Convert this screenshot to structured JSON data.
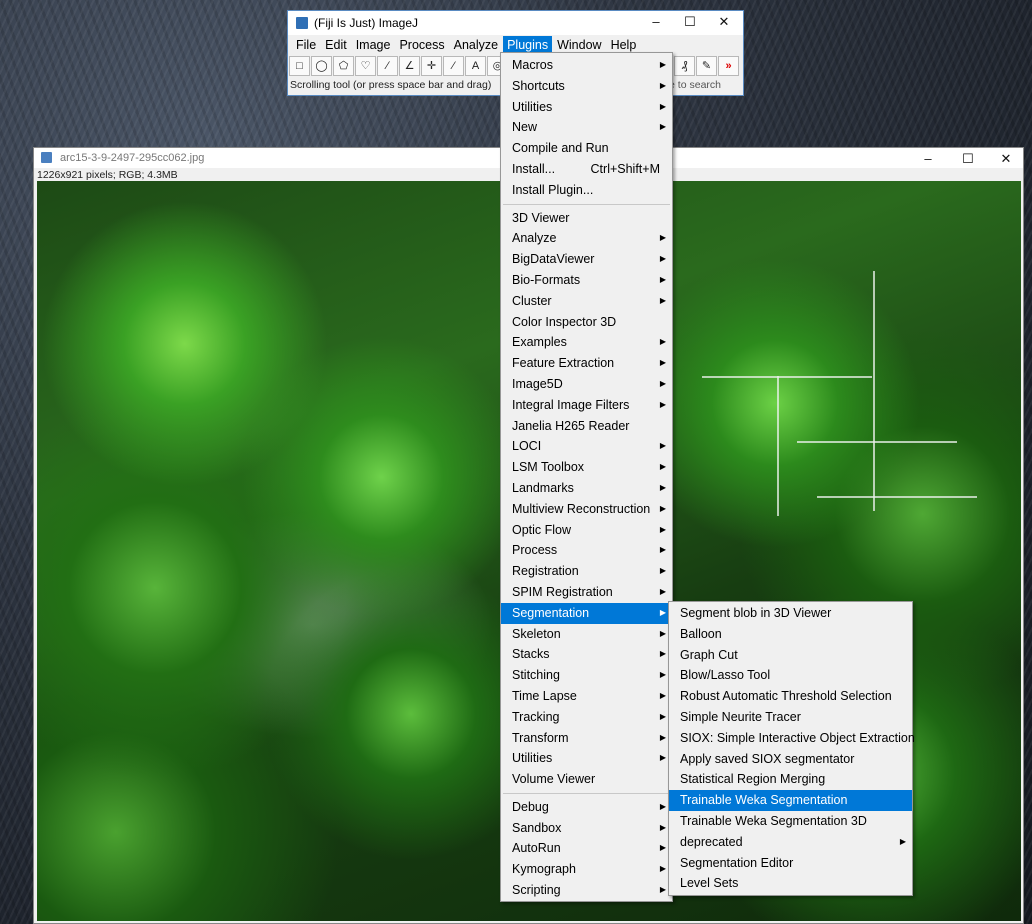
{
  "main_window": {
    "title": "(Fiji Is Just) ImageJ",
    "menubar": [
      "File",
      "Edit",
      "Image",
      "Process",
      "Analyze",
      "Plugins",
      "Window",
      "Help"
    ],
    "active_menu": "Plugins",
    "tools": [
      "rectangle-tool",
      "oval-tool",
      "polygon-tool",
      "freehand-tool",
      "line-tool",
      "angle-tool",
      "point-tool",
      "wand-tool",
      "text-tool",
      "zoom-tool"
    ],
    "right_tools": [
      "image-tool",
      "developer-tool",
      "more-tools"
    ],
    "tool_glyphs": [
      "□",
      "◯",
      "⬠",
      "♡",
      "∕",
      "∠",
      "✛",
      "⁄",
      "A",
      "◎"
    ],
    "right_glyphs": [
      "₰",
      "✎",
      "»"
    ],
    "status": "Scrolling tool (or press space bar and drag)",
    "status_right": "e to search"
  },
  "image_window": {
    "title": "arc15-3-9-2497-295cc062.jpg",
    "info": "1226x921 pixels; RGB; 4.3MB"
  },
  "plugins_menu": {
    "group1": [
      {
        "label": "Macros",
        "sub": true
      },
      {
        "label": "Shortcuts",
        "sub": true
      },
      {
        "label": "Utilities",
        "sub": true
      },
      {
        "label": "New",
        "sub": true
      },
      {
        "label": "Compile and Run"
      },
      {
        "label": "Install...",
        "accel": "Ctrl+Shift+M"
      },
      {
        "label": "Install Plugin..."
      }
    ],
    "group2": [
      {
        "label": "3D Viewer"
      },
      {
        "label": "Analyze",
        "sub": true
      },
      {
        "label": "BigDataViewer",
        "sub": true
      },
      {
        "label": "Bio-Formats",
        "sub": true
      },
      {
        "label": "Cluster",
        "sub": true
      },
      {
        "label": "Color Inspector 3D"
      },
      {
        "label": "Examples",
        "sub": true
      },
      {
        "label": "Feature Extraction",
        "sub": true
      },
      {
        "label": "Image5D",
        "sub": true
      },
      {
        "label": "Integral Image Filters",
        "sub": true
      },
      {
        "label": "Janelia H265 Reader"
      },
      {
        "label": "LOCI",
        "sub": true
      },
      {
        "label": "LSM Toolbox",
        "sub": true
      },
      {
        "label": "Landmarks",
        "sub": true
      },
      {
        "label": "Multiview Reconstruction",
        "sub": true
      },
      {
        "label": "Optic Flow",
        "sub": true
      },
      {
        "label": "Process",
        "sub": true
      },
      {
        "label": "Registration",
        "sub": true
      },
      {
        "label": "SPIM Registration",
        "sub": true
      },
      {
        "label": "Segmentation",
        "sub": true,
        "highlight": true
      },
      {
        "label": "Skeleton",
        "sub": true
      },
      {
        "label": "Stacks",
        "sub": true
      },
      {
        "label": "Stitching",
        "sub": true
      },
      {
        "label": "Time Lapse",
        "sub": true
      },
      {
        "label": "Tracking",
        "sub": true
      },
      {
        "label": "Transform",
        "sub": true
      },
      {
        "label": "Utilities",
        "sub": true
      },
      {
        "label": "Volume Viewer"
      }
    ],
    "group3": [
      {
        "label": "Debug",
        "sub": true
      },
      {
        "label": "Sandbox",
        "sub": true
      },
      {
        "label": "AutoRun",
        "sub": true
      },
      {
        "label": "Kymograph",
        "sub": true
      },
      {
        "label": "Scripting",
        "sub": true
      }
    ]
  },
  "segmentation_menu": [
    {
      "label": "Segment blob in 3D Viewer"
    },
    {
      "label": "Balloon"
    },
    {
      "label": "Graph Cut"
    },
    {
      "label": "Blow/Lasso Tool"
    },
    {
      "label": "Robust Automatic Threshold Selection"
    },
    {
      "label": "Simple Neurite Tracer"
    },
    {
      "label": "SIOX: Simple Interactive Object Extraction"
    },
    {
      "label": "Apply saved SIOX segmentator"
    },
    {
      "label": "Statistical Region Merging"
    },
    {
      "label": "Trainable Weka Segmentation",
      "highlight": true
    },
    {
      "label": "Trainable Weka Segmentation 3D"
    },
    {
      "label": "deprecated",
      "sub": true
    },
    {
      "label": "Segmentation Editor"
    },
    {
      "label": "Level Sets"
    }
  ],
  "colors": {
    "highlight": "#0078d7",
    "menu_bg": "#f0f0f0"
  }
}
